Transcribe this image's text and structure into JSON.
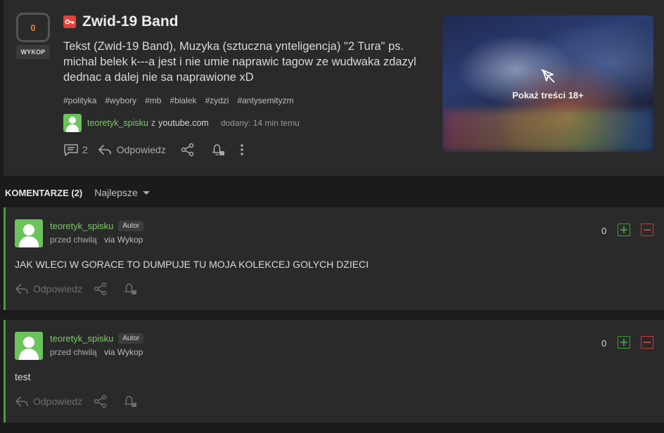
{
  "post": {
    "vote_count": "0",
    "wykop_label": "WYKOP",
    "title": "Zwid-19 Band",
    "description": "Tekst (Zwid-19 Band), Muzyka (sztuczna ynteligencja) \"2 Tura\" ps. michal belek k---a jest i nie umie naprawic tagow ze wudwaka zdazyl dednac a dalej nie sa naprawione xD",
    "tags": [
      "#polityka",
      "#wybory",
      "#mb",
      "#bialek",
      "#zydzi",
      "#antysemityzm"
    ],
    "author": "teoretyk_spisku",
    "via": "z",
    "source": "youtube.com",
    "added": "dodany: 14 min temu",
    "comments_count": "2",
    "reply_label": "Odpowiedz",
    "nsfw_label": "Pokaż treści 18+"
  },
  "comments_section": {
    "header": "KOMENTARZE (2)",
    "sort_label": "Najlepsze"
  },
  "comments": [
    {
      "author": "teoretyk_spisku",
      "badge": "Autor",
      "time": "przed chwilą",
      "via": "via Wykop",
      "score": "0",
      "text": "JAK WLECI W GORACE TO DUMPUJE TU MOJA KOLEKCEJ GOLYCH DZIECI",
      "reply_label": "Odpowiedz"
    },
    {
      "author": "teoretyk_spisku",
      "badge": "Autor",
      "time": "przed chwilą",
      "via": "via Wykop",
      "score": "0",
      "text": "test",
      "reply_label": "Odpowiedz"
    }
  ],
  "colors": {
    "accent_orange": "#ef7a2a",
    "author_green": "#7bc96a",
    "plus_green": "#3e9b3e",
    "minus_red": "#c93c3c",
    "key_red": "#e3423f"
  }
}
